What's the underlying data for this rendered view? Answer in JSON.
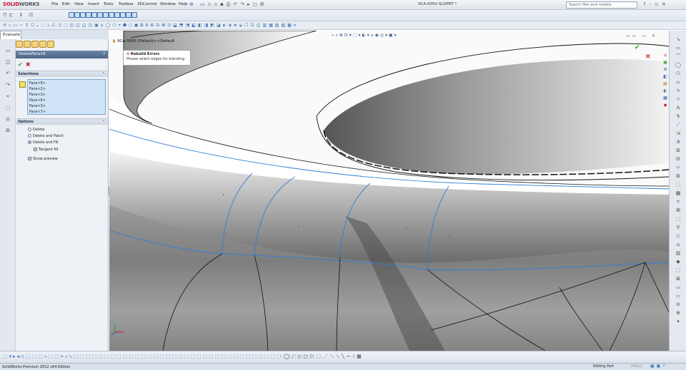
{
  "app": {
    "logo_main": "SOLID",
    "logo_sub": "WORKS",
    "document_title": "XCA-0050-SLDPRT *",
    "search_placeholder": "Search files and models"
  },
  "menu": [
    "File",
    "Edit",
    "View",
    "Insert",
    "Tools",
    "Toolbox",
    "3DControl",
    "Window",
    "Help"
  ],
  "command_manager": {
    "active_tab": "Evaluate"
  },
  "property_manager": {
    "feature_name": "DeleteFace18",
    "help_label": "?",
    "selections_header": "Selections",
    "selections": [
      "Face<5>",
      "Face<2>",
      "Face<1>",
      "Face<6>",
      "Face<3>",
      "Face<7>"
    ],
    "options_header": "Options",
    "options": [
      {
        "label": "Delete",
        "selected": false
      },
      {
        "label": "Delete and Patch",
        "selected": false
      },
      {
        "label": "Delete and Fill",
        "selected": true
      }
    ],
    "tangent_fill_label": "Tangent fill",
    "tangent_fill_checked": true,
    "show_preview_label": "Show preview",
    "show_preview_checked": true
  },
  "viewport": {
    "breadcrumb": "XCA-0050 (Default<<Default",
    "rebuild_title": "Rebuild Errors",
    "rebuild_message": "Please select edges for blending"
  },
  "status": {
    "edition": "SolidWorks Premium 2012 x64 Edition",
    "mode": "Editing Part",
    "units": "MMGS"
  },
  "colors": {
    "accent": "#3b6fb3",
    "ok_green": "#2a9d2a",
    "cancel_red": "#c8102e",
    "selection_blue": "#cfe4f7",
    "edge_blue": "#2f7fd6"
  }
}
